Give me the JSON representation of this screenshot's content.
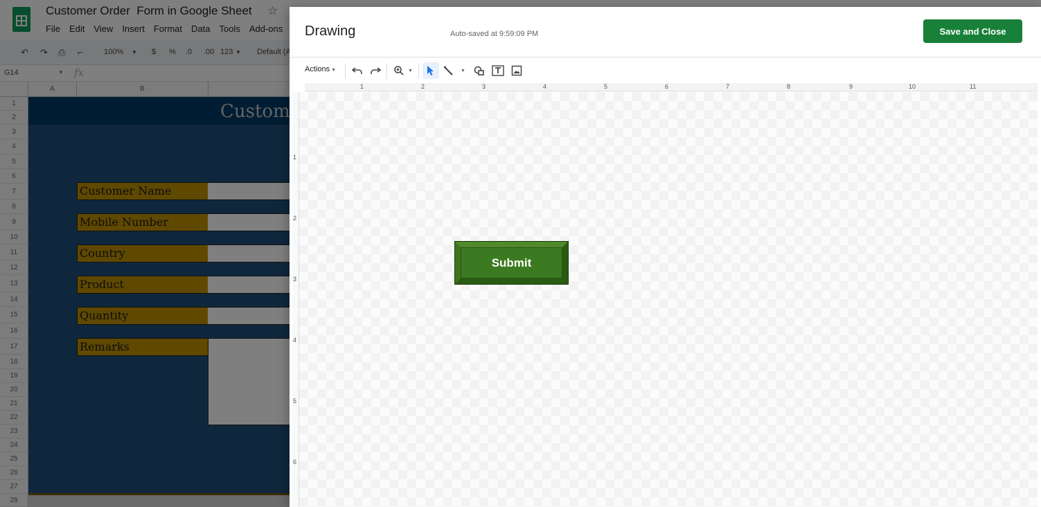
{
  "sheets": {
    "doc_title": "Customer Order  Form in Google Sheet",
    "menu": [
      "File",
      "Edit",
      "View",
      "Insert",
      "Format",
      "Data",
      "Tools",
      "Add-ons"
    ],
    "toolbar": {
      "zoom": "100%",
      "currency": "$",
      "percent": "%",
      "dec_decrease": ".0",
      "dec_increase": ".00",
      "more_formats": "123",
      "font": "Default (A"
    },
    "name_box": "G14",
    "columns": [
      "A",
      "B"
    ],
    "rows": [
      "1",
      "2",
      "3",
      "4",
      "5",
      "6",
      "7",
      "8",
      "9",
      "10",
      "11",
      "12",
      "13",
      "14",
      "15",
      "16",
      "17",
      "18",
      "19",
      "20",
      "21",
      "22",
      "23",
      "24",
      "25",
      "26",
      "27",
      "28"
    ],
    "form_title": "Custom",
    "fields": [
      "Customer Name",
      "Mobile Number",
      "Country",
      "Product",
      "Quantity",
      "Remarks"
    ]
  },
  "drawing": {
    "title": "Drawing",
    "autosave": "Auto-saved at 9:59:09 PM",
    "save_close": "Save and Close",
    "actions": "Actions",
    "ruler_h": [
      "1",
      "2",
      "3",
      "4",
      "5",
      "6",
      "7",
      "8",
      "9",
      "10",
      "11"
    ],
    "ruler_v": [
      "1",
      "2",
      "3",
      "4",
      "5",
      "6"
    ],
    "submit_label": "Submit"
  },
  "colors": {
    "accent": "#188038",
    "form_bg": "#1f4e79",
    "label_gold": "#bf9000",
    "button_green": "#3b7a20"
  }
}
